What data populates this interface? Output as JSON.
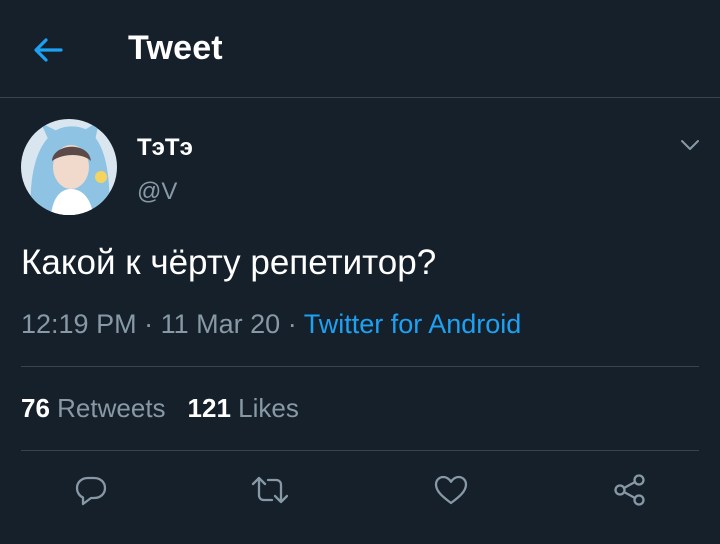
{
  "header": {
    "title": "Tweet",
    "back_icon": "arrow-left-icon"
  },
  "tweet": {
    "display_name": "ТэТэ",
    "handle": "@V",
    "text": "Какой к чёрту репетитор?",
    "time": "12:19 PM",
    "date": "11 Mar 20",
    "separator": "·",
    "source": "Twitter for Android"
  },
  "stats": {
    "retweets_count": "76",
    "retweets_label": "Retweets",
    "likes_count": "121",
    "likes_label": "Likes"
  },
  "actions": {
    "icons": [
      "reply-icon",
      "retweet-icon",
      "like-icon",
      "share-icon"
    ]
  },
  "colors": {
    "background": "#15202b",
    "divider": "#38444d",
    "accent": "#1da1f2",
    "secondary_text": "#8899a6",
    "primary_text": "#ffffff"
  }
}
